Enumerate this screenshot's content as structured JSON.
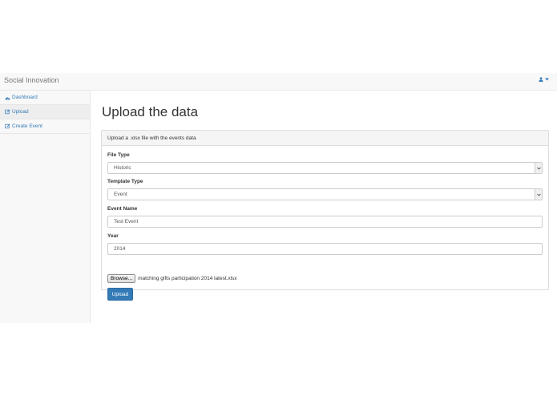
{
  "navbar": {
    "brand": "Social Innovation",
    "user_icon": "user-icon",
    "caret_icon": "caret-down-icon"
  },
  "sidebar": {
    "items": [
      {
        "label": "Dashboard",
        "icon": "dashboard-icon"
      },
      {
        "label": "Upload",
        "icon": "edit-icon"
      },
      {
        "label": "Create Event",
        "icon": "edit-icon"
      }
    ]
  },
  "main": {
    "title": "Upload the data",
    "panel_heading": "Upload a .xlsx file with the events data",
    "file_type": {
      "label": "File Type",
      "value": "Historic"
    },
    "template_type": {
      "label": "Template Type",
      "value": "Event"
    },
    "event_name": {
      "label": "Event Name",
      "value": "Test Event"
    },
    "year": {
      "label": "Year",
      "value": "2014"
    },
    "file": {
      "browse_label": "Browse...",
      "filename": "matching gifts participation 2014 latest.xlsx"
    },
    "upload_label": "Upload"
  },
  "colors": {
    "link": "#337ab7",
    "primary_button": "#337ab7"
  }
}
